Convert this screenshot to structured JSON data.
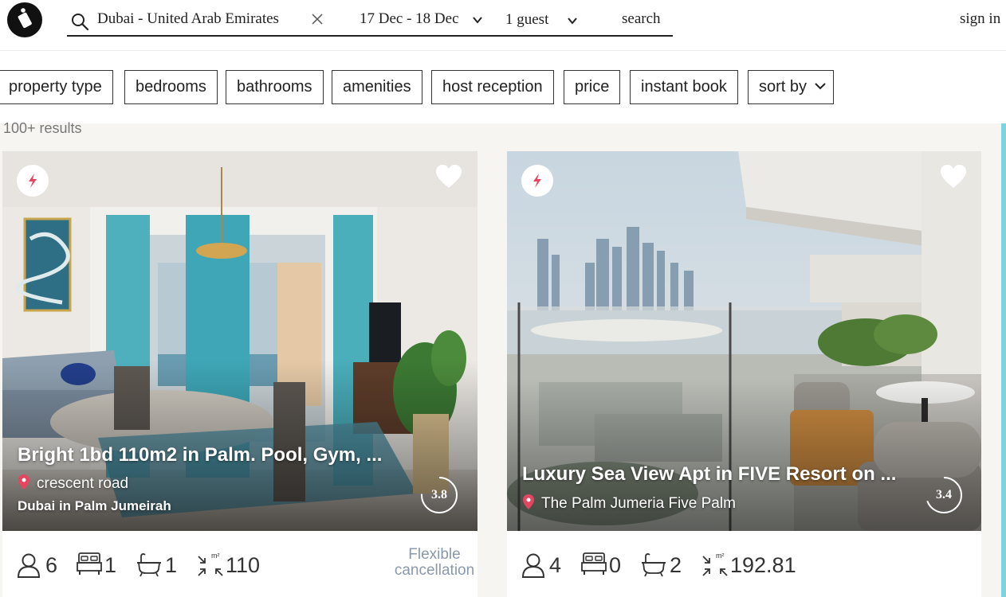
{
  "header": {
    "location": "Dubai - United Arab Emirates",
    "dates": "17 Dec - 18 Dec",
    "guests": "1 guest",
    "search_label": "search",
    "sign_in": "sign in"
  },
  "filters": [
    "property type",
    "bedrooms",
    "bathrooms",
    "amenities",
    "host reception",
    "price",
    "instant book",
    "sort by"
  ],
  "results_count": "100+ results",
  "listings": [
    {
      "title": "Bright 1bd 110m2 in Palm. Pool, Gym, ...",
      "street": "crescent road",
      "area": "Dubai in Palm Jumeirah",
      "rating": "3.8",
      "guests": "6",
      "bedrooms": "1",
      "bathrooms": "1",
      "size": "110",
      "cancellation": "Flexible cancellation"
    },
    {
      "title": "Luxury Sea View Apt in FIVE Resort on ...",
      "street": "The Palm Jumeria Five Palm",
      "rating": "3.4",
      "guests": "4",
      "bedrooms": "0",
      "bathrooms": "2",
      "size": "192.81"
    }
  ],
  "colors": {
    "accent_red": "#e64560",
    "rail": "#7ed3dd",
    "cancellation_text": "#8a98ab"
  },
  "icons": [
    "logo-icon",
    "search-icon",
    "clear-icon",
    "chevron-down-icon",
    "flash-icon",
    "heart-icon",
    "location-pin-icon",
    "guests-icon",
    "bed-icon",
    "bathtub-icon",
    "area-icon"
  ]
}
